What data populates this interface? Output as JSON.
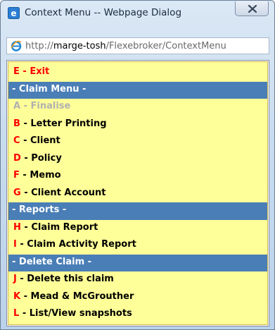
{
  "window": {
    "title": "Context Menu -- Webpage Dialog",
    "close_glyph": "X",
    "icon": "internet-explorer-icon"
  },
  "address": {
    "prefix": "http://",
    "host": "marge-tosh",
    "path": "/Flexebroker/ContextMenu"
  },
  "colors": {
    "menu_background": "#ffff99",
    "header_background": "#4a7eb6",
    "shortcut_key": "#ff0000",
    "disabled_text": "#b0b0b0"
  },
  "menu": {
    "exit": {
      "key": "E",
      "label": " - Exit"
    },
    "claim_header": "- Claim Menu -",
    "claim_items": [
      {
        "key": "A",
        "label": " - Finalise",
        "disabled": true
      },
      {
        "key": "B",
        "label": " - Letter Printing"
      },
      {
        "key": "C",
        "label": " - Client"
      },
      {
        "key": "D",
        "label": " - Policy"
      },
      {
        "key": "F",
        "label": " - Memo"
      },
      {
        "key": "G",
        "label": " - Client Account"
      }
    ],
    "reports_header": "- Reports -",
    "report_items": [
      {
        "key": "H",
        "label": " - Claim Report"
      },
      {
        "key": "I",
        "label": " - Claim Activity Report"
      }
    ],
    "delete_header": "- Delete Claim -",
    "delete_items": [
      {
        "key": "J",
        "label": " - Delete this claim"
      },
      {
        "key": "K",
        "label": " - Mead & McGrouther"
      },
      {
        "key": "L",
        "label": " - List/View snapshots"
      }
    ]
  }
}
